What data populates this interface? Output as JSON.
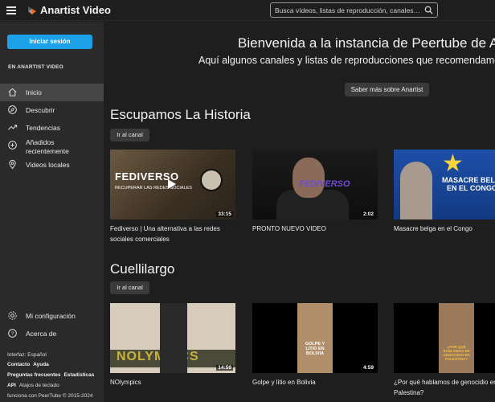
{
  "header": {
    "brand": "Anartist Video",
    "search_placeholder": "Busca vídeos, listas de reproducción, canales…"
  },
  "sidebar": {
    "login_label": "Iniciar sesión",
    "section_title": "EN ANARTIST VIDEO",
    "items": [
      {
        "label": "Inicio",
        "icon": "home-icon"
      },
      {
        "label": "Descubrir",
        "icon": "discover-icon"
      },
      {
        "label": "Tendencias",
        "icon": "trending-icon"
      },
      {
        "label": "Añadidos recientemente",
        "icon": "add-circle-icon"
      },
      {
        "label": "Videos locales",
        "icon": "location-icon"
      }
    ],
    "config_label": "Mi configuración",
    "about_label": "Acerca de",
    "footer": {
      "interface": "Interfaz: Español",
      "contacto": "Contacto",
      "ayuda": "Ayuda",
      "faq": "Preguntas frecuentes",
      "stats": "Estadísticas",
      "api": "API",
      "shortcuts": "Atajos de teclado",
      "powered": "funciona con PeerTube © 2015-2024"
    }
  },
  "main": {
    "welcome_title": "Bienvenida a la instancia de Peertube de Anartist",
    "welcome_subtitle": "Aquí algunos canales y listas de reproducciones que recomendamos",
    "more_label": "Saber más sobre Anartist",
    "sections": [
      {
        "title": "Escupamos La Historia",
        "channel_button": "Ir al canal",
        "videos": [
          {
            "title": "Fediverso | Una alternativa a las redes sociales comerciales",
            "duration": "33:15",
            "thumb_text": "FEDIVERSO",
            "thumb_sub": "RECUPERAR LAS REDES SOCIALES"
          },
          {
            "title": "PRONTO NUEVO VIDEO",
            "duration": "2:02",
            "thumb_text": "FEDIVERSO"
          },
          {
            "title": "Masacre belga en el Congo",
            "duration": "",
            "thumb_text1": "MASACRE BELGA",
            "thumb_text2": "EN EL CONGO"
          }
        ]
      },
      {
        "title": "Cuellilargo",
        "channel_button": "Ir al canal",
        "videos": [
          {
            "title": "NOlympics",
            "duration": "14:59",
            "thumb_text": "NOLYMPICS"
          },
          {
            "title": "Golpe y litio en Bolivia",
            "duration": "4:59",
            "thumb_text": "GOLPE Y LITIO EN BOLIVIA"
          },
          {
            "title": "¿Por qué hablamos de genocidio en Palestina?",
            "duration": "",
            "thumb_text": "¿POR QUÉ HABLAMOS DE GENOCIDIO EN PALESTINA?"
          }
        ]
      }
    ]
  },
  "colors": {
    "accent": "#1ca0e8",
    "background": "#1e1e1e",
    "sidebar": "#2a2a2a",
    "logo_orange": "#f1680d"
  }
}
